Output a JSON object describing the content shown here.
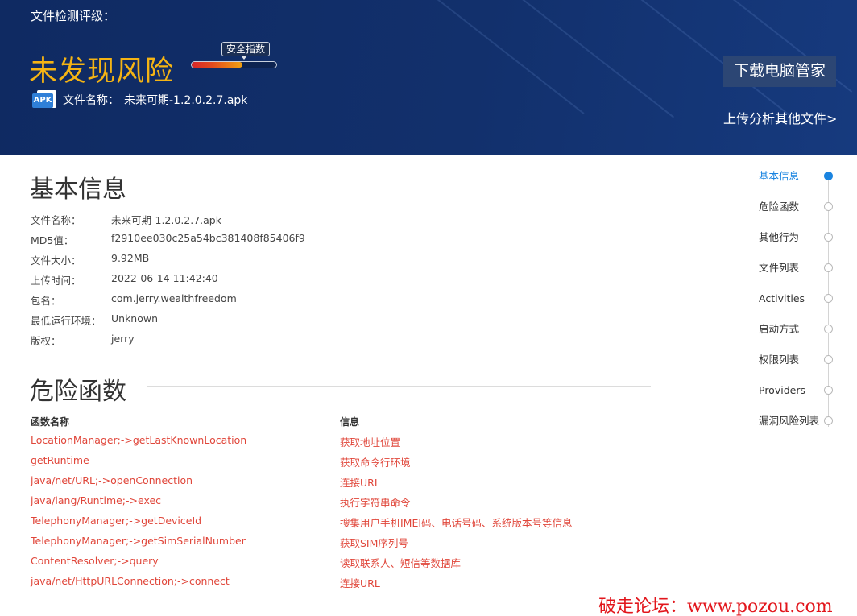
{
  "header": {
    "label": "文件检测评级：",
    "verdict": "未发现风险",
    "gauge_tag": "安全指数",
    "gauge_level": 0.6,
    "file_icon": "APK",
    "file_name_label": "文件名称：",
    "file_name": "未来可期-1.2.0.2.7.apk",
    "download_button": "下载电脑管家",
    "upload_link": "上传分析其他文件>"
  },
  "basic_info": {
    "title": "基本信息",
    "rows": [
      {
        "k": "文件名称：",
        "v": "未来可期-1.2.0.2.7.apk"
      },
      {
        "k": "MD5值：",
        "v": "f2910ee030c25a54bc381408f85406f9"
      },
      {
        "k": "文件大小：",
        "v": "9.92MB"
      },
      {
        "k": "上传时间：",
        "v": "2022-06-14 11:42:40"
      },
      {
        "k": "包名：",
        "v": "com.jerry.wealthfreedom"
      },
      {
        "k": "最低运行环境：",
        "v": "Unknown"
      },
      {
        "k": "版权：",
        "v": "jerry"
      }
    ]
  },
  "danger_functions": {
    "title": "危险函数",
    "col_name": "函数名称",
    "col_info": "信息",
    "rows": [
      {
        "fn": "LocationManager;->getLastKnownLocation",
        "info": "获取地址位置"
      },
      {
        "fn": "getRuntime",
        "info": "获取命令行环境"
      },
      {
        "fn": "java/net/URL;->openConnection",
        "info": "连接URL"
      },
      {
        "fn": "java/lang/Runtime;->exec",
        "info": "执行字符串命令"
      },
      {
        "fn": "TelephonyManager;->getDeviceId",
        "info": "搜集用户手机IMEI码、电话号码、系统版本号等信息"
      },
      {
        "fn": "TelephonyManager;->getSimSerialNumber",
        "info": "获取SIM序列号"
      },
      {
        "fn": "ContentResolver;->query",
        "info": "读取联系人、短信等数据库"
      },
      {
        "fn": "java/net/HttpURLConnection;->connect",
        "info": "连接URL"
      }
    ]
  },
  "side_nav": {
    "items": [
      {
        "label": "基本信息",
        "active": true
      },
      {
        "label": "危险函数",
        "active": false
      },
      {
        "label": "其他行为",
        "active": false
      },
      {
        "label": "文件列表",
        "active": false
      },
      {
        "label": "Activities",
        "active": false
      },
      {
        "label": "启动方式",
        "active": false
      },
      {
        "label": "权限列表",
        "active": false
      },
      {
        "label": "Providers",
        "active": false
      },
      {
        "label": "漏洞风险列表",
        "active": false
      }
    ]
  },
  "watermark": "破走论坛：www.pozou.com",
  "colors": {
    "banner": "#12306c",
    "verdict": "#f5b414",
    "danger_text": "#e0463a",
    "nav_active": "#1a84e0",
    "button_bg": "#2c4674"
  }
}
